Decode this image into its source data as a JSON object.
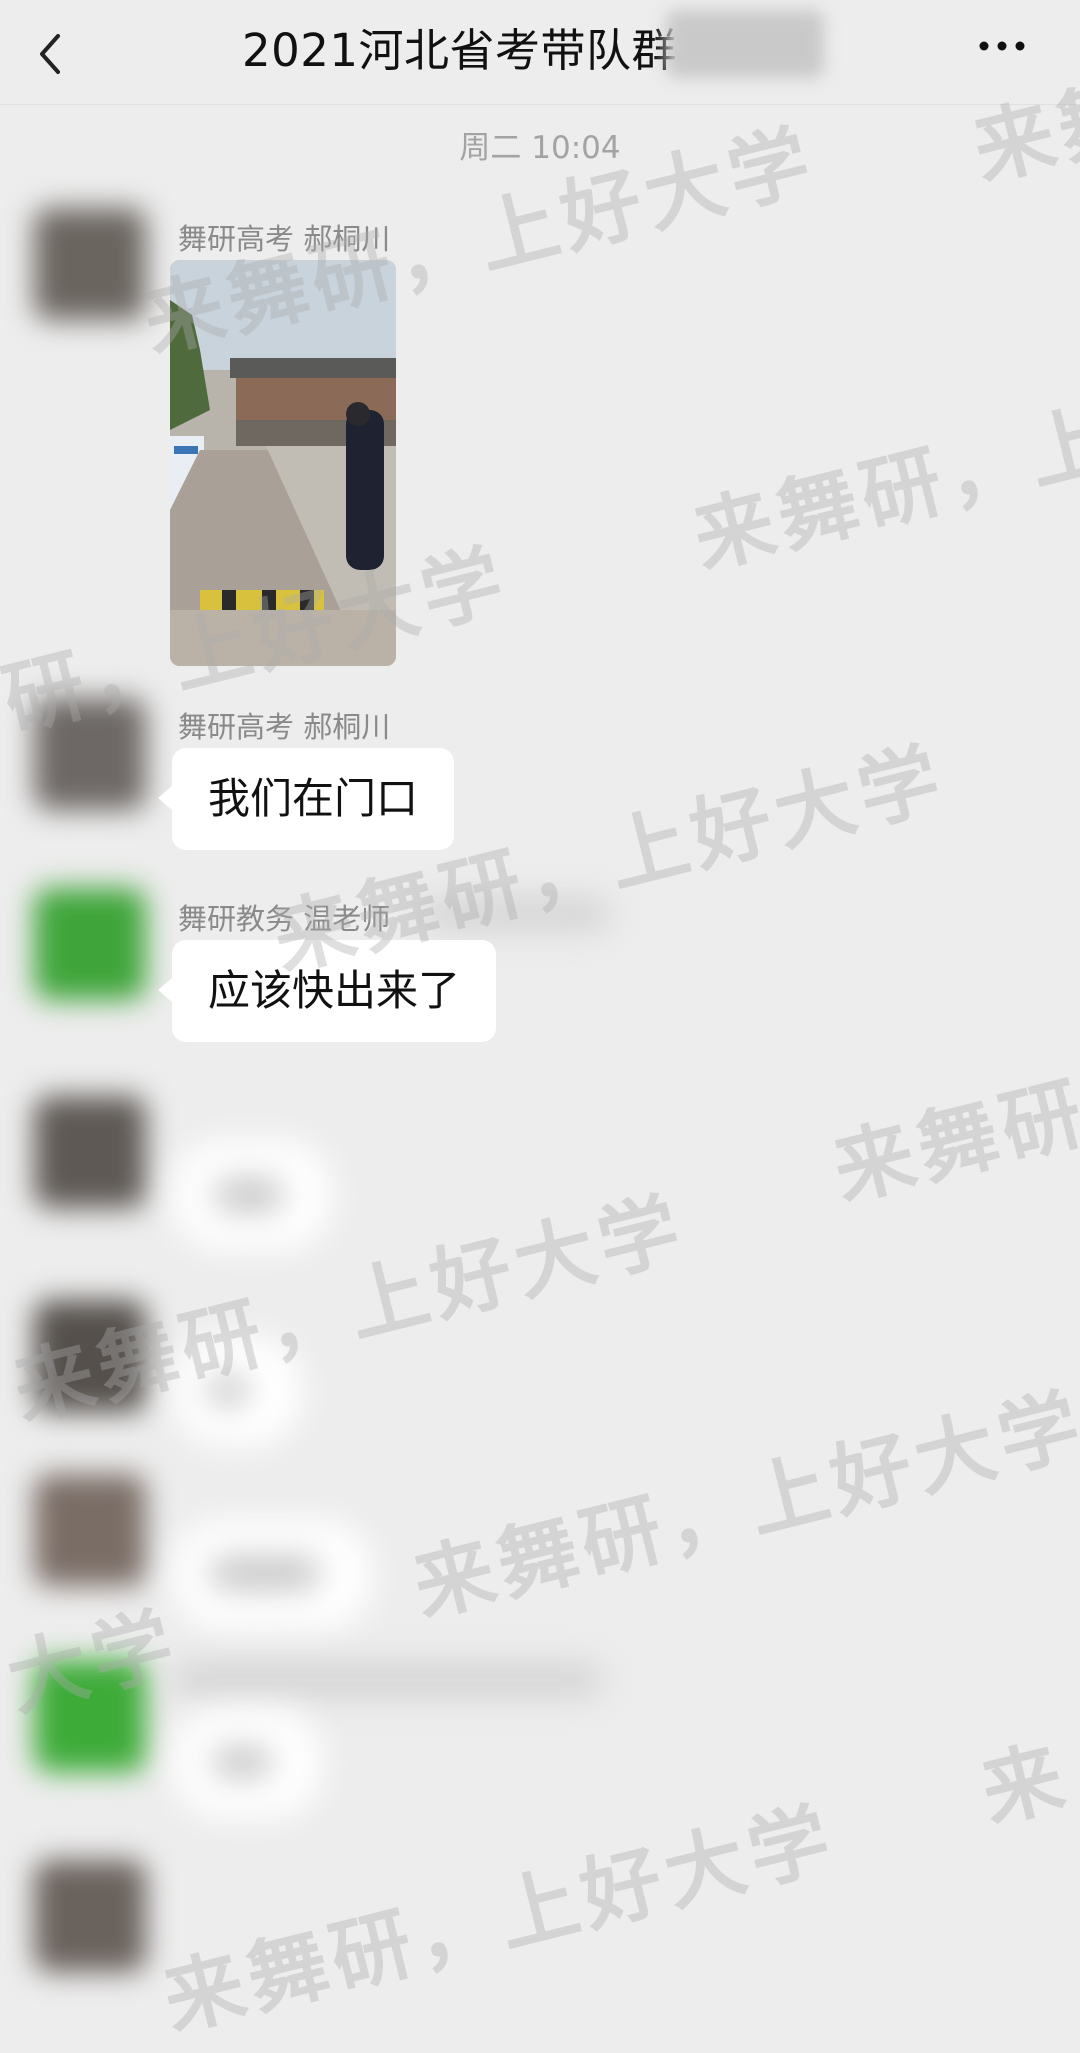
{
  "header": {
    "title": "2021河北省考带队群",
    "back_icon": "chevron-left-icon",
    "more_icon": "more-dots-icon"
  },
  "chat": {
    "timestamp": "周二 10:04",
    "messages": [
      {
        "sender": "舞研高考 郝桐川",
        "type": "image"
      },
      {
        "sender": "舞研高考 郝桐川",
        "text": "我们在门口"
      },
      {
        "sender": "舞研教务 温老师",
        "text": "应该快出来了"
      }
    ]
  },
  "watermarks": {
    "w1": "来舞研，上好大学",
    "w2": "来舞研，上",
    "w3": "研，上好大学",
    "w4": "来舞研，上好大学",
    "w5": "来舞研",
    "w6": "来舞研，上好大学",
    "w7": "来舞研，上好大学",
    "w8": "大学",
    "w9": "来舞",
    "w10": "来舞研，上好大学",
    "w11": "来"
  },
  "colors": {
    "background": "#ededed",
    "bubble": "#ffffff",
    "text": "#111111",
    "name_text": "#8a8a8a"
  }
}
